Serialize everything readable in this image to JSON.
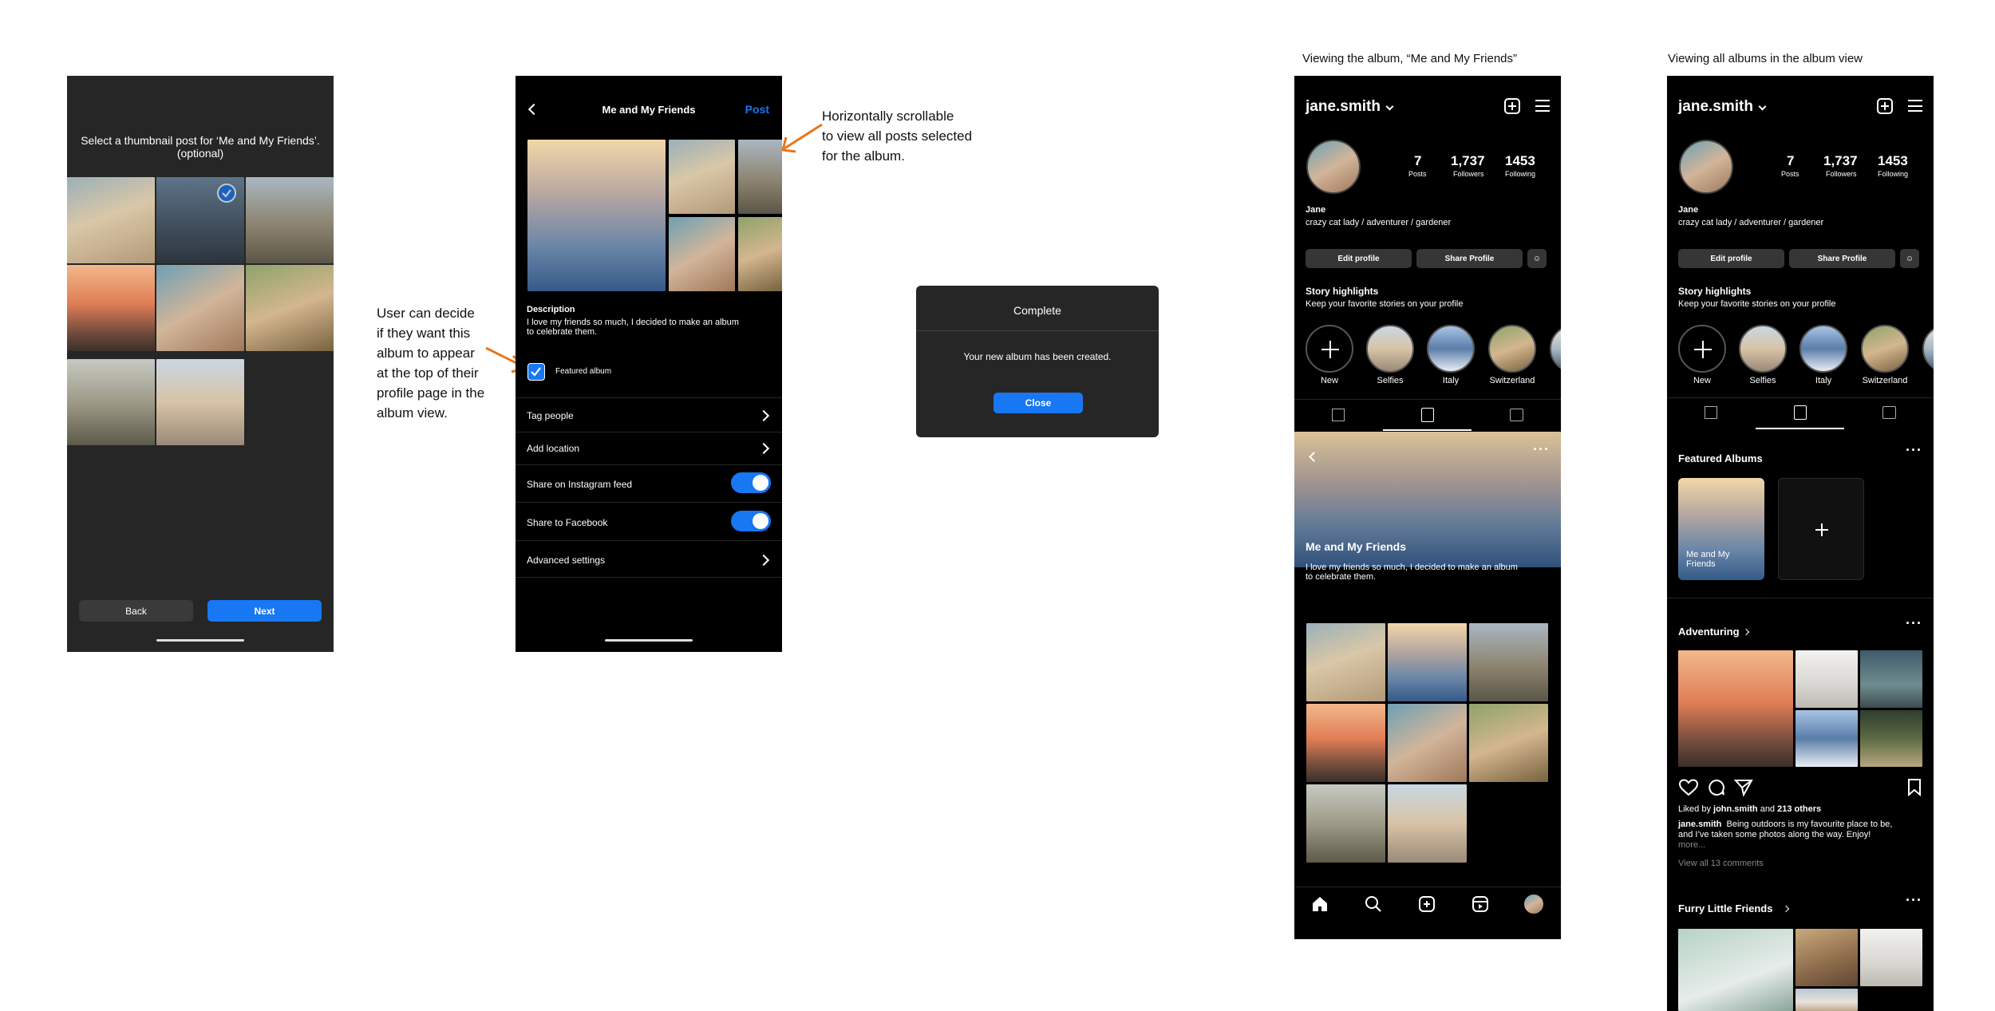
{
  "annotations": {
    "scroll_note": [
      "Horizontally scrollable",
      "to view all posts selected",
      "for the album."
    ],
    "featured_note": [
      "User can decide",
      "if they want this",
      "album to appear",
      "at the top of their",
      "profile page in the",
      "album view."
    ],
    "caption_album": "Viewing the album, “Me and My Friends”",
    "caption_all": "Viewing all albums in the album view"
  },
  "screen1": {
    "prompt_line1": "Select a thumbnail post for ‘Me and My Friends’.",
    "prompt_line2": "(optional)",
    "back_label": "Back",
    "next_label": "Next"
  },
  "screen2": {
    "title": "Me and My Friends",
    "post_label": "Post",
    "description_heading": "Description",
    "description_text1": "I love my friends so much, I decided to make an album",
    "description_text2": "to celebrate them.",
    "featured_label": "Featured album",
    "rows": [
      {
        "label": "Tag people"
      },
      {
        "label": "Add location"
      },
      {
        "label": "Share on Instagram feed"
      },
      {
        "label": "Share to Facebook"
      },
      {
        "label": "Advanced settings"
      }
    ]
  },
  "dialog": {
    "title": "Complete",
    "message": "Your new album has been created.",
    "close_label": "Close"
  },
  "profile": {
    "username": "jane.smith",
    "posts_count": "7",
    "posts_label": "Posts",
    "followers_count": "1,737",
    "followers_label": "Followers",
    "following_count": "1453",
    "following_label": "Following",
    "name": "Jane",
    "bio": "crazy cat lady / adventurer / gardener",
    "edit_profile": "Edit profile",
    "share_profile": "Share Profile",
    "highlights_title": "Story highlights",
    "highlights_sub": "Keep your favorite stories on your profile",
    "highlights": [
      "New",
      "Selfies",
      "Italy",
      "Switzerland"
    ]
  },
  "album_view": {
    "album_title": "Me and My Friends",
    "album_desc1": "I love my friends so much, I decided to make an album",
    "album_desc2": "to celebrate them."
  },
  "albums_view": {
    "featured_title": "Featured Albums",
    "featured_album_label1": "Me and My",
    "featured_album_label2": "Friends",
    "adventuring_title": "Adventuring",
    "liked_by_prefix": "Liked by ",
    "liked_by_user": "john.smith",
    "liked_by_mid": " and ",
    "liked_by_others": "213 others",
    "caption_user": "jane.smith",
    "caption_text1": "Being outdoors is my favourite place to be,",
    "caption_text2": "and I’ve taken some photos along the way. Enjoy!",
    "caption_more": "more...",
    "view_comments": "View all 13 comments",
    "furry_title": "Furry Little Friends"
  },
  "colors": {
    "accent": "#1877f2",
    "annotation_arrow": "#e8761a",
    "screen_bg_dark": "#262626",
    "screen_bg": "#000000"
  }
}
